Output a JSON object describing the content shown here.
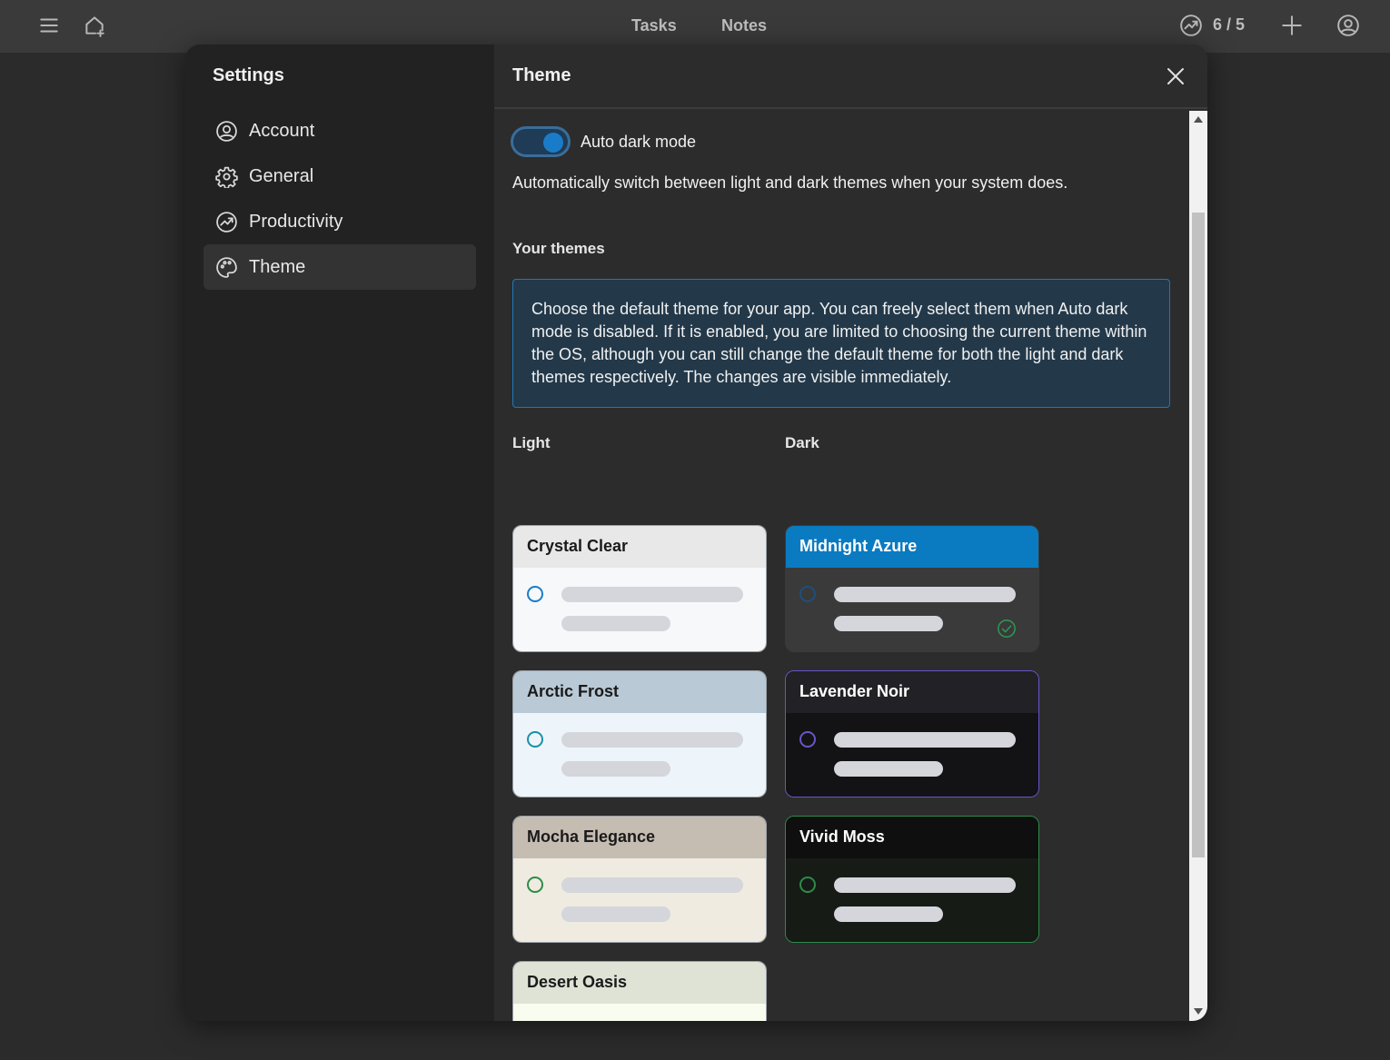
{
  "topbar": {
    "tabs": [
      "Tasks",
      "Notes"
    ],
    "counter": "6 / 5",
    "icons": [
      "menu-icon",
      "home-add-icon",
      "productivity-icon",
      "plus-icon",
      "user-icon"
    ]
  },
  "settings": {
    "title": "Settings",
    "nav": [
      {
        "label": "Account",
        "icon": "user-circle-icon"
      },
      {
        "label": "General",
        "icon": "gear-icon"
      },
      {
        "label": "Productivity",
        "icon": "trend-icon"
      },
      {
        "label": "Theme",
        "icon": "palette-icon",
        "active": true
      }
    ]
  },
  "theme_panel": {
    "title": "Theme",
    "auto_dark_mode": {
      "label": "Auto dark mode",
      "enabled": true,
      "description": "Automatically switch between light and dark themes when your system does."
    },
    "your_themes_title": "Your themes",
    "info": "Choose the default theme for your app. You can freely select them when Auto dark mode is disabled. If it is enabled, you are limited to choosing the current theme within the OS, although you can still change the default theme for both the light and dark themes respectively. The changes are visible immediately.",
    "light_label": "Light",
    "dark_label": "Dark",
    "light_themes": [
      {
        "name": "Crystal Clear",
        "header_bg": "#e8e8e8",
        "body_bg": "#f7f8fa",
        "text": "#1a1a1a",
        "accent": "#1a7cc9"
      },
      {
        "name": "Arctic Frost",
        "header_bg": "#b9c9d6",
        "body_bg": "#eef5fa",
        "text": "#1a1a1a",
        "accent": "#1a8fa8"
      },
      {
        "name": "Mocha Elegance",
        "header_bg": "#c5bcb2",
        "body_bg": "#efebe0",
        "text": "#1a1a1a",
        "accent": "#2e8a4a"
      },
      {
        "name": "Desert Oasis",
        "header_bg": "#dfe3d6",
        "body_bg": "#f8fdf0",
        "text": "#1a1a1a",
        "accent": "#2e8a4a"
      }
    ],
    "dark_themes": [
      {
        "name": "Midnight Azure",
        "header_bg": "#0b7bc1",
        "body_bg": "#3a3a3a",
        "text": "#ffffff",
        "accent": "#1f4f7a",
        "selected": true
      },
      {
        "name": "Lavender Noir",
        "header_bg": "#222125",
        "body_bg": "#131215",
        "text": "#ffffff",
        "accent": "#6a55c8"
      },
      {
        "name": "Vivid Moss",
        "header_bg": "#0f0f0f",
        "body_bg": "#161b16",
        "text": "#ffffff",
        "accent": "#2f8a4a"
      }
    ]
  }
}
